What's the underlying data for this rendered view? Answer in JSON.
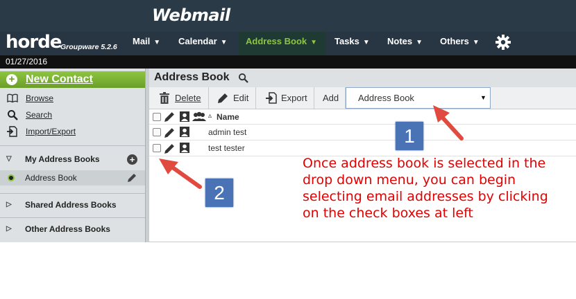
{
  "banner": {
    "title": "Webmail"
  },
  "app": {
    "logo": "horde",
    "subtitle": "Groupware 5.2.6"
  },
  "nav": {
    "items": [
      {
        "label": "Mail",
        "icon": "chevron-down-icon"
      },
      {
        "label": "Calendar",
        "icon": "chevron-down-icon"
      },
      {
        "label": "Address Book",
        "icon": "chevron-down-icon",
        "active": true
      },
      {
        "label": "Tasks",
        "icon": "chevron-down-icon"
      },
      {
        "label": "Notes",
        "icon": "chevron-down-icon"
      },
      {
        "label": "Others",
        "icon": "chevron-down-icon"
      }
    ],
    "settings_icon": "gear-icon"
  },
  "date": "01/27/2016",
  "sidebar": {
    "new_contact": "New Contact",
    "links": [
      {
        "label": "Browse",
        "icon": "book-icon"
      },
      {
        "label": "Search",
        "icon": "search-icon"
      },
      {
        "label": "Import/Export",
        "icon": "import-export-icon"
      }
    ],
    "my_books": "My Address Books",
    "book_item": "Address Book",
    "shared_books": "Shared Address Books",
    "other_books": "Other Address Books"
  },
  "main": {
    "title": "Address Book",
    "toolbar": {
      "delete": "Delete",
      "edit": "Edit",
      "export": "Export",
      "add": "Add",
      "select_value": "Address Book"
    },
    "column_name": "Name",
    "sort_mark": "▵",
    "rows": [
      {
        "name": "admin test"
      },
      {
        "name": "test tester"
      }
    ]
  },
  "annotations": {
    "callout_1": "1",
    "callout_2": "2",
    "note": "Once address book is selected in the drop down menu, you can begin selecting email addresses by clicking on the check boxes at left",
    "color": "#e30000"
  },
  "colors": {
    "banner": "#2b3a47",
    "nav": "#283542",
    "accent_green": "#8dc63f",
    "callout_blue": "#4a73b5"
  }
}
